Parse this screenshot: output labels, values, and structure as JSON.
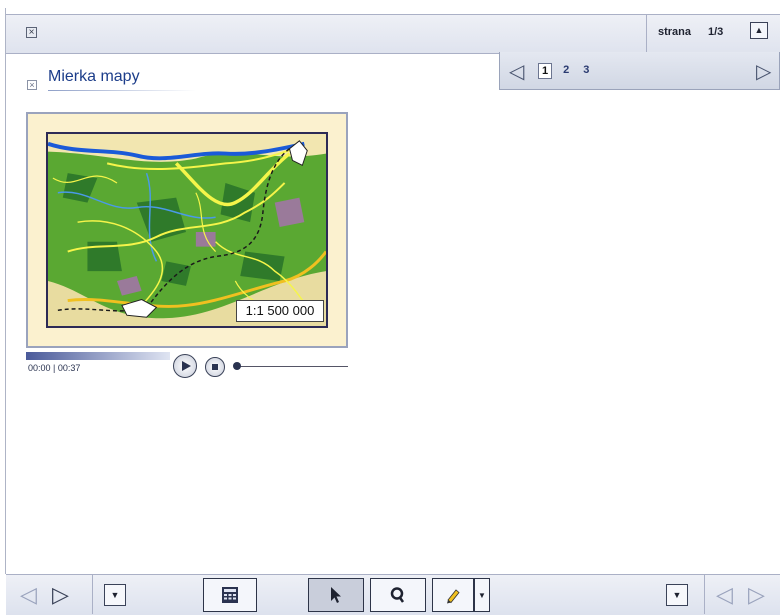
{
  "topbar": {
    "page_label": "strana",
    "page_number": "1/3",
    "up_button_symbol": "▲"
  },
  "pager": {
    "prev_symbol": "◁",
    "next_symbol": "▷",
    "pages": [
      "1",
      "2",
      "3"
    ],
    "active_page": "1"
  },
  "section": {
    "title": "Mierka mapy"
  },
  "media": {
    "scale_label": "1:1 500 000",
    "time_current": "00:00",
    "time_total": "00:37",
    "time_text": "00:00 | 00:37",
    "progress": 0.0
  },
  "bottombar": {
    "prev_symbol": "◁",
    "next_symbol": "▷",
    "dropdown_symbol": "▼"
  },
  "icons": {
    "close": "close-icon",
    "calculator": "calculator-icon",
    "pointer": "pointer-icon",
    "search": "search-icon",
    "pencil": "pencil-icon"
  }
}
